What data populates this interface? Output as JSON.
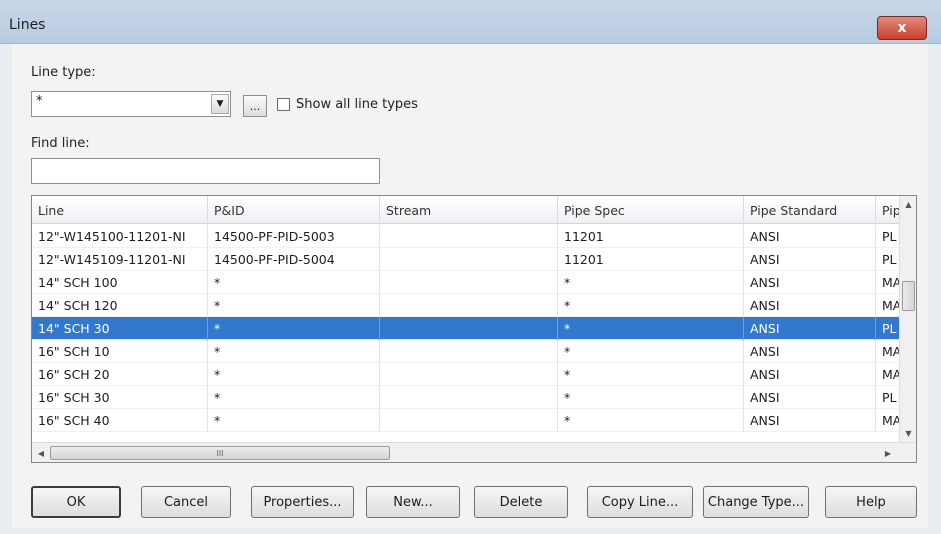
{
  "window": {
    "title": "Lines",
    "close_glyph": "x"
  },
  "line_type": {
    "label": "Line type:",
    "value": "*",
    "dropdown_glyph": "▼",
    "browse_label": "...",
    "show_all_label": "Show all line types",
    "show_all_checked": false
  },
  "find_line": {
    "label": "Find line:",
    "value": ""
  },
  "grid": {
    "columns": [
      "Line",
      "P&ID",
      "Stream",
      "Pipe Spec",
      "Pipe Standard",
      "Pip"
    ],
    "rows": [
      {
        "line": "12\"-W145100-11201-NI",
        "pid": "14500-PF-PID-5003",
        "stream": "",
        "spec": "11201",
        "standard": "ANSI",
        "pip": "PL"
      },
      {
        "line": "12\"-W145109-11201-NI",
        "pid": "14500-PF-PID-5004",
        "stream": "",
        "spec": "11201",
        "standard": "ANSI",
        "pip": "PL"
      },
      {
        "line": "14\" SCH 100",
        "pid": "*",
        "stream": "",
        "spec": "*",
        "standard": "ANSI",
        "pip": "MA"
      },
      {
        "line": "14\" SCH 120",
        "pid": "*",
        "stream": "",
        "spec": "*",
        "standard": "ANSI",
        "pip": "MA"
      },
      {
        "line": "14\" SCH 30",
        "pid": "*",
        "stream": "",
        "spec": "*",
        "standard": "ANSI",
        "pip": "PL",
        "selected": true
      },
      {
        "line": "16\" SCH 10",
        "pid": "*",
        "stream": "",
        "spec": "*",
        "standard": "ANSI",
        "pip": "MA"
      },
      {
        "line": "16\" SCH 20",
        "pid": "*",
        "stream": "",
        "spec": "*",
        "standard": "ANSI",
        "pip": "MA"
      },
      {
        "line": "16\" SCH 30",
        "pid": "*",
        "stream": "",
        "spec": "*",
        "standard": "ANSI",
        "pip": "PL"
      },
      {
        "line": "16\" SCH 40",
        "pid": "*",
        "stream": "",
        "spec": "*",
        "standard": "ANSI",
        "pip": "MA"
      }
    ],
    "scroll": {
      "up": "▲",
      "down": "▼",
      "left": "◀",
      "right": "▶",
      "grip": "III"
    }
  },
  "buttons": {
    "ok": "OK",
    "cancel": "Cancel",
    "properties": "Properties...",
    "new": "New...",
    "delete": "Delete",
    "copy_line": "Copy Line...",
    "change_type": "Change Type...",
    "help": "Help"
  }
}
